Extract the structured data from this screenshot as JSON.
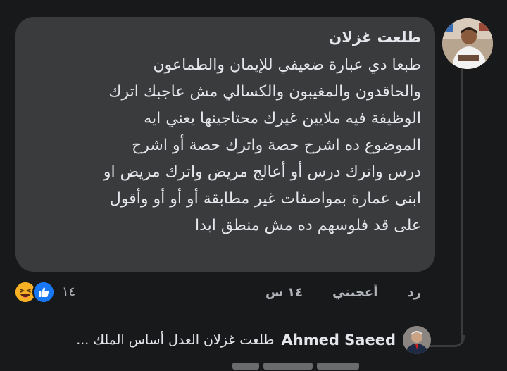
{
  "comment": {
    "author": "طلعت غزلان",
    "lines": [
      "طبعا دي عبارة ضعيفي للإيمان والطماعون",
      "والحاقدون والمغيبون والكسالي   مش عاجبك اترك",
      "الوظيفة فيه ملايين غيرك محتاجينها يعني ايه",
      "الموضوع ده اشرح حصة واترك حصة أو اشرح",
      "درس واترك درس أو أعالج مريض واترك مريض او",
      "ابنى عمارة بمواصفات غير مطابقة أو أو أو وأقول",
      "على قد فلوسهم  ده مش منطق ابدا"
    ],
    "time": "١٤ س",
    "like_label": "أعجبني",
    "reply_label": "رد",
    "reactions": {
      "count": "١٤",
      "icons": [
        "haha-icon",
        "like-icon"
      ]
    }
  },
  "reply": {
    "author": "Ahmed Saeed",
    "text": "طلعت غزلان العدل أساس الملك ..."
  },
  "colors": {
    "background": "#18191a",
    "bubble": "#3a3b3c",
    "text": "#e4e6eb",
    "secondary_text": "#b0b3b8",
    "like_blue": "#1877f2",
    "haha_yellow": "#f7b125"
  }
}
